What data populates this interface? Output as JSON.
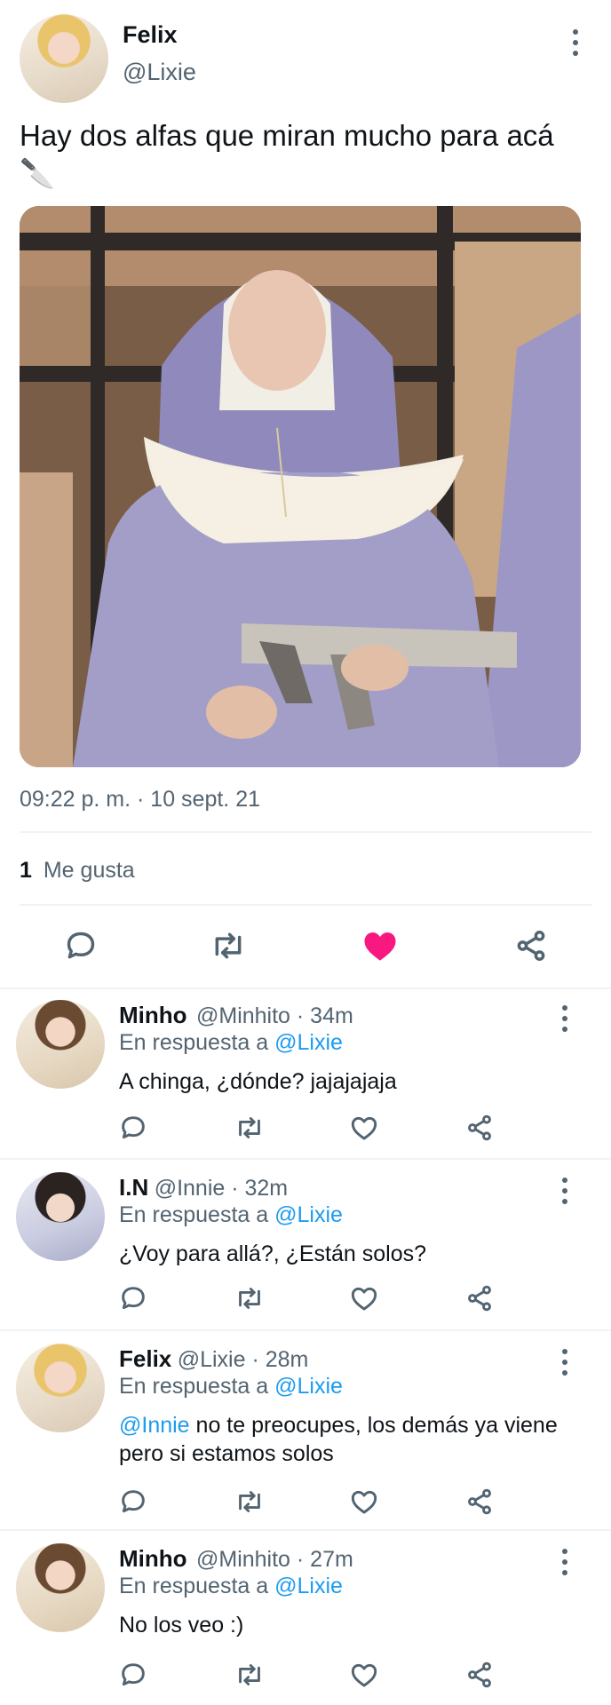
{
  "tweet": {
    "author_name": "Felix",
    "author_handle": "@Lixie",
    "text": "Hay dos alfas que miran mucho para acá",
    "emoji": "🔪",
    "timestamp": "09:22 p. m. · 10 sept. 21",
    "likes_count": "1",
    "likes_label": "Me gusta",
    "liked": true,
    "image_alt": "nun-holding-rifle-photo"
  },
  "replies": [
    {
      "name": "Minho",
      "meta": "@Minhito · 34m",
      "reply_prefix": "En respuesta a ",
      "reply_to": "@Lixie",
      "mention": "",
      "text": "A chinga, ¿dónde? jajajajaja"
    },
    {
      "name": "I.N",
      "meta": "@Innie · 32m",
      "reply_prefix": "En respuesta a ",
      "reply_to": "@Lixie",
      "mention": "",
      "text": "¿Voy para allá?, ¿Están solos?"
    },
    {
      "name": "Felix",
      "meta": "@Lixie · 28m",
      "reply_prefix": "En respuesta a ",
      "reply_to": "@Lixie",
      "mention": "@Innie",
      "text": " no te preocupes, los demás ya viene pero si estamos solos"
    },
    {
      "name": "Minho",
      "meta": "@Minhito · 27m",
      "reply_prefix": "En respuesta a ",
      "reply_to": "@Lixie",
      "mention": "",
      "text": "No los veo :)"
    }
  ],
  "colors": {
    "accent": "#1d9bf0",
    "like": "#f91880",
    "muted": "#536471"
  }
}
